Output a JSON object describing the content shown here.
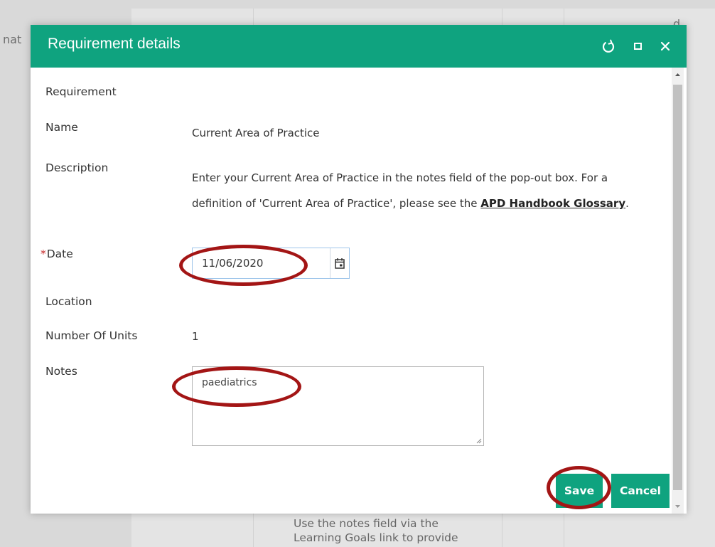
{
  "background": {
    "left_fragment": "nat",
    "right_fragment": "d",
    "bottom_lines": [
      "Use the notes field via the",
      "Learning Goals link to provide"
    ]
  },
  "dialog": {
    "title": "Requirement details",
    "header_icons": [
      "refresh-icon",
      "maximize-icon",
      "close-icon"
    ],
    "section_title": "Requirement",
    "fields": {
      "name_label": "Name",
      "name_value": "Current Area of Practice",
      "description_label": "Description",
      "description_text": "Enter your Current Area of Practice in the notes field of the pop-out box. For a definition of 'Current Area of Practice', please see the ",
      "description_link": "APD Handbook Glossary",
      "description_end": ".",
      "date_required_mark": "*",
      "date_label": "Date",
      "date_value": "11/06/2020",
      "location_label": "Location",
      "units_label": "Number Of Units",
      "units_value": "1",
      "notes_label": "Notes",
      "notes_value": "paediatrics"
    },
    "buttons": {
      "save": "Save",
      "cancel": "Cancel"
    }
  },
  "colors": {
    "accent": "#0fa37f",
    "annotation": "#a31515",
    "required": "#c62828"
  }
}
